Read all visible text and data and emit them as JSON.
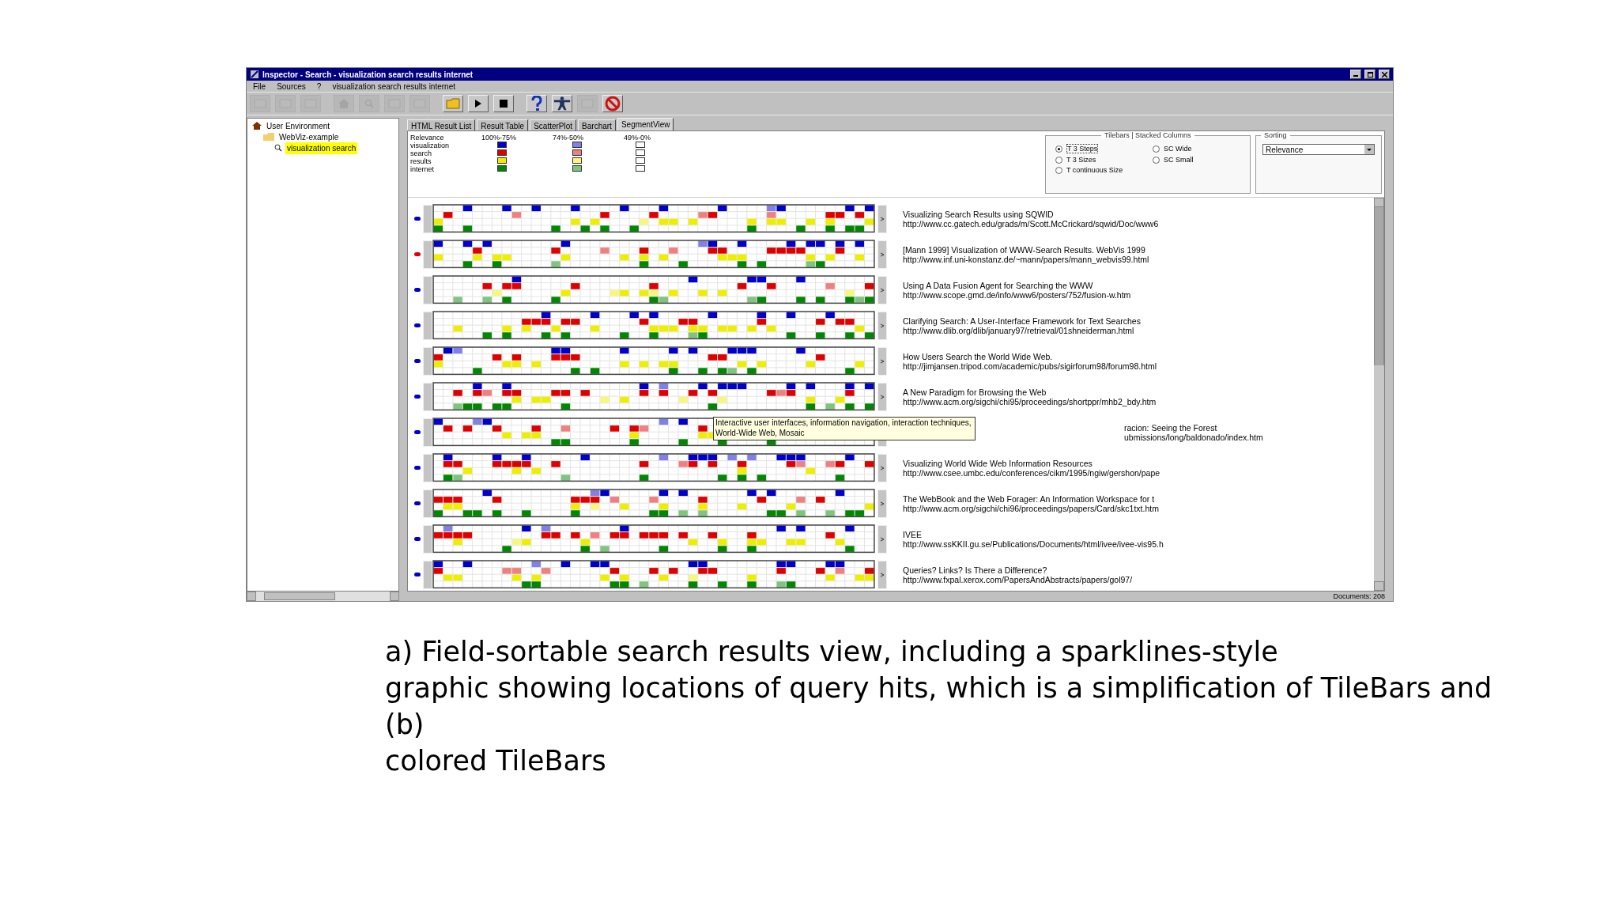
{
  "window": {
    "title": "Inspector - Search - visualization search results internet"
  },
  "menu": [
    "File",
    "Sources",
    "?",
    "visualization search results internet"
  ],
  "toolbar": [
    {
      "kind": "blank",
      "disabled": true
    },
    {
      "kind": "blank",
      "disabled": true
    },
    {
      "kind": "blank",
      "disabled": true
    },
    {
      "kind": "home",
      "disabled": true
    },
    {
      "kind": "search",
      "disabled": true
    },
    {
      "kind": "blank",
      "disabled": true
    },
    {
      "kind": "blank",
      "disabled": true
    },
    {
      "kind": "folder",
      "disabled": false
    },
    {
      "kind": "play",
      "disabled": false
    },
    {
      "kind": "stop",
      "disabled": false
    },
    {
      "kind": "help",
      "disabled": false
    },
    {
      "kind": "figure",
      "disabled": false
    },
    {
      "kind": "blank",
      "disabled": true
    },
    {
      "kind": "cancel",
      "disabled": false
    }
  ],
  "tree": [
    {
      "label": "User Environment",
      "selected": false,
      "children": [
        {
          "label": "WebViz-example",
          "selected": false,
          "children": [
            {
              "label": "visualization search",
              "selected": true
            }
          ]
        }
      ]
    }
  ],
  "tabs": [
    {
      "label": "HTML Result List",
      "selected": false
    },
    {
      "label": "Result Table",
      "selected": false
    },
    {
      "label": "ScatterPlot",
      "selected": false
    },
    {
      "label": "Barchart",
      "selected": false
    },
    {
      "label": "SegmentView",
      "selected": true
    }
  ],
  "legend": {
    "heading": "Relevance",
    "ranges": [
      "100%-75%",
      "74%-50%",
      "49%-0%"
    ],
    "terms": [
      {
        "label": "visualization",
        "color": "#0000cc"
      },
      {
        "label": "search",
        "color": "#e00000"
      },
      {
        "label": "results",
        "color": "#eeee00"
      },
      {
        "label": "internet",
        "color": "#008800"
      }
    ]
  },
  "tilebar_options": {
    "title": "Tilebars | Stacked Columns",
    "options": [
      {
        "label": "T 3 Steps",
        "selected": true
      },
      {
        "label": "T 3 Sizes",
        "selected": false
      },
      {
        "label": "T continuous Size",
        "selected": false
      },
      {
        "label": "SC Wide",
        "selected": false
      },
      {
        "label": "SC Small",
        "selected": false
      }
    ]
  },
  "sorting": {
    "title": "Sorting",
    "value": "Relevance"
  },
  "results": [
    {
      "color": "#0000cc",
      "title": "Visualizing Search Results using SQWID",
      "url": "http://www.cc.gatech.edu/grads/m/Scott.McCrickard/sqwid/Doc/www6"
    },
    {
      "color": "#e00000",
      "title": "[Mann 1999] Visualization of WWW-Search Results. WebVis 1999",
      "url": "http://www.inf.uni-konstanz.de/~mann/papers/mann_webvis99.html"
    },
    {
      "color": "#0000cc",
      "title": "Using A Data Fusion Agent for Searching the WWW",
      "url": "http://www.scope.gmd.de/info/www6/posters/752/fusion-w.htm"
    },
    {
      "color": "#0000cc",
      "title": "Clarifying Search: A User-Interface Framework for Text Searches",
      "url": "http://www.dlib.org/dlib/january97/retrieval/01shneiderman.html"
    },
    {
      "color": "#0000cc",
      "title": "How Users Search the World Wide Web.",
      "url": "http://jimjansen.tripod.com/academic/pubs/sigirforum98/forum98.html"
    },
    {
      "color": "#0000cc",
      "title": "A New Paradigm for Browsing the Web",
      "url": "http://www.acm.org/sigchi/chi95/proceedings/shortppr/mhb2_bdy.htm"
    },
    {
      "color": "#0000cc",
      "title": "racion: Seeing the Forest",
      "url": "ubmissions/long/baldonado/index.htm",
      "tooltip": [
        "Interactive user interfaces, information navigation, interaction techniques,",
        "World-Wide Web, Mosaic"
      ]
    },
    {
      "color": "#0000cc",
      "title": "Visualizing World Wide Web Information Resources",
      "url": "http://www.csee.umbc.edu/conferences/cikm/1995/ngiw/gershon/pape"
    },
    {
      "color": "#0000cc",
      "title": "The WebBook and the Web Forager: An Information Workspace for t",
      "url": "http://www.acm.org/sigchi/chi96/proceedings/papers/Card/skc1txt.htm"
    },
    {
      "color": "#0000cc",
      "title": "IVEE",
      "url": "http://www.ssKKII.gu.se/Publications/Documents/html/ivee/ivee-vis95.h"
    },
    {
      "color": "#0000cc",
      "title": "Queries? Links? Is There a Difference?",
      "url": "http://www.fxpal.xerox.com/PapersAndAbstracts/papers/gol97/"
    }
  ],
  "status": "Documents: 208",
  "caption": "a) Field-sortable search results view, including a sparklines-style\ngraphic showing locations of query hits, which is a simplification of TileBars and\n(b)\ncolored TileBars"
}
